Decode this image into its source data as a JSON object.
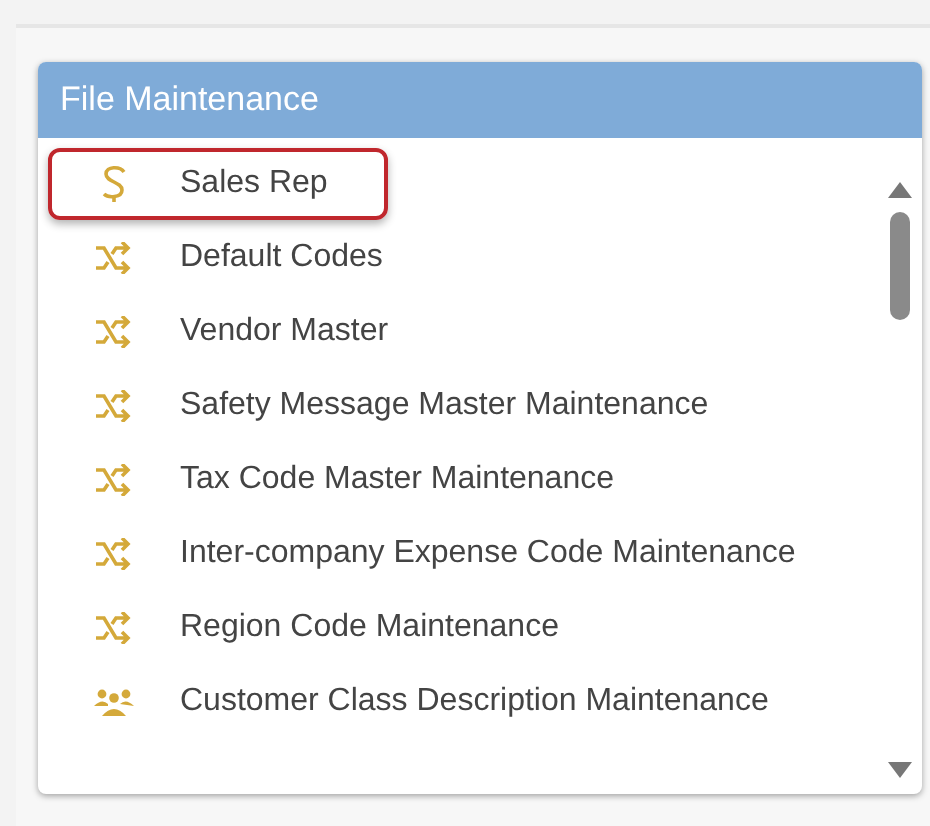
{
  "panel": {
    "title": "File Maintenance"
  },
  "items": [
    {
      "label": "Sales Rep",
      "kind": "dollar",
      "selected": true
    },
    {
      "label": "Default Codes",
      "kind": "shuffle",
      "selected": false
    },
    {
      "label": "Vendor Master",
      "kind": "shuffle",
      "selected": false
    },
    {
      "label": "Safety Message Master Maintenance",
      "kind": "shuffle",
      "selected": false
    },
    {
      "label": "Tax Code Master Maintenance",
      "kind": "shuffle",
      "selected": false
    },
    {
      "label": "Inter-company Expense Code Maintenance",
      "kind": "shuffle",
      "selected": false
    },
    {
      "label": "Region Code Maintenance",
      "kind": "shuffle",
      "selected": false
    },
    {
      "label": "Customer Class Description Maintenance",
      "kind": "people",
      "selected": false
    }
  ]
}
